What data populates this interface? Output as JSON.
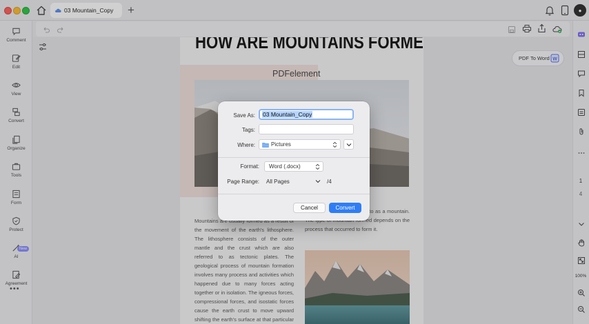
{
  "tab": {
    "title": "03 Mountain_Copy"
  },
  "sidebar": {
    "items": [
      {
        "label": "Comment",
        "icon": "comment-icon"
      },
      {
        "label": "Edit",
        "icon": "edit-icon"
      },
      {
        "label": "View",
        "icon": "view-icon"
      },
      {
        "label": "Convert",
        "icon": "convert-icon"
      },
      {
        "label": "Organize",
        "icon": "organize-icon"
      },
      {
        "label": "Tools",
        "icon": "tools-icon"
      },
      {
        "label": "Form",
        "icon": "form-icon"
      },
      {
        "label": "Protect",
        "icon": "protect-icon"
      },
      {
        "label": "AI",
        "icon": "ai-icon"
      },
      {
        "label": "Agreement",
        "icon": "agreement-icon"
      }
    ],
    "new_badge": "New",
    "more": "•••"
  },
  "document": {
    "heading": "HOW ARE MOUNTAINS FORMED?",
    "brand_label": "PDFelement",
    "col_left": "Mountains are usually formed as a result of the movement of the earth's lithosphere. The lithosphere consists of the outer mantle and the crust which are also referred to as tectonic plates. The geological process of mountain formation involves many process and activities which happened due to many forces acting together or in isolation. The igneous forces, compressional forces, and isostatic forces cause the earth crust to move upward shifting the earth's surface at that particular place to be higher than the",
    "col_right": "surround it what is referred to as a mountain. The type of mountain formed depends on the process that occurred to form it."
  },
  "pdf_to_word": {
    "label": "PDF To Word"
  },
  "page_nav": {
    "current": "1",
    "total": "4",
    "zoom": "100%"
  },
  "dialog": {
    "save_as_label": "Save As:",
    "save_as_value": "03 Mountain_Copy",
    "tags_label": "Tags:",
    "where_label": "Where:",
    "where_value": "Pictures",
    "format_label": "Format:",
    "format_value": "Word (.docx)",
    "range_label": "Page Range:",
    "range_value": "All Pages",
    "range_total": "/4",
    "cancel_label": "Cancel",
    "convert_label": "Convert"
  },
  "colors": {
    "accent": "#2f7df6",
    "traffic_red": "#ff5f57",
    "traffic_yellow": "#febc2e",
    "traffic_green": "#28c840"
  }
}
